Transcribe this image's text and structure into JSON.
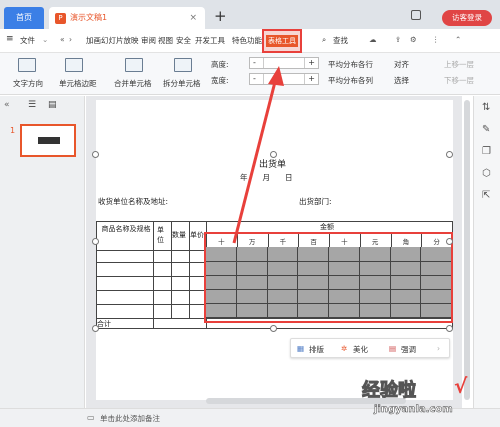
{
  "tabs": {
    "home": "首页",
    "doc_title": "演示文稿1",
    "new_tab": "+",
    "visit_login": "访客登录"
  },
  "menu": {
    "file": "文件",
    "items": [
      "加画",
      "幻灯片放映",
      "审阅",
      "视图",
      "安全",
      "开发工具",
      "特色功能"
    ],
    "table_tools": "表格工具",
    "search": "查找"
  },
  "toolbar": {
    "text_direction": "文字方向",
    "cell_margin": "单元格边距",
    "merge_cells": "合并单元格",
    "split_cells": "拆分单元格",
    "height_label": "高度:",
    "width_label": "宽度:",
    "height_value": "-",
    "width_value": "-",
    "dist_rows": "平均分布各行",
    "dist_cols": "平均分布各列",
    "align": "对齐",
    "select": "选择",
    "up_one": "上移一层",
    "down_one": "下移一层"
  },
  "slides": {
    "number": "1"
  },
  "slide": {
    "title": "出货单",
    "date": "年　　月　　日",
    "receiver": "收货单位名称及地址:",
    "dept": "出货部门:",
    "col_product": "商品名称及规格",
    "col_unit": "单位",
    "col_qty": "数量",
    "col_price": "单价",
    "col_amount": "金额",
    "amount_digits": [
      "十",
      "万",
      "千",
      "百",
      "十",
      "元",
      "角",
      "分"
    ],
    "total": "合计"
  },
  "float_bar": {
    "layout": "排版",
    "beautify": "美化",
    "emphasize": "强调"
  },
  "status": {
    "notes": "单击此处添加备注",
    "add": "+"
  },
  "watermark": {
    "main": "经验啦",
    "check": "√",
    "url": "jingyanla.com"
  },
  "colors": {
    "accent": "#e8562b",
    "highlight": "#e8403b",
    "home_tab": "#3b7fe6",
    "login": "#e04545"
  }
}
